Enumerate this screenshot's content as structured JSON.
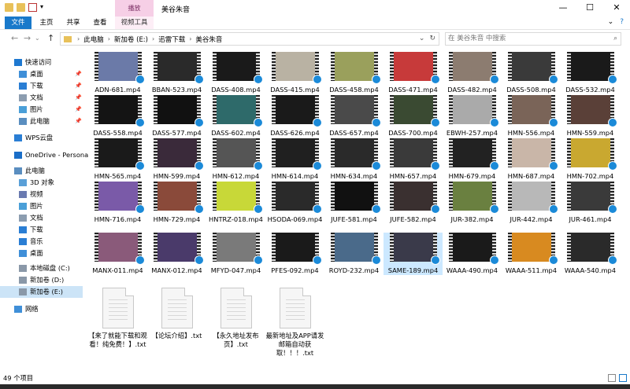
{
  "window": {
    "title": "美谷朱音",
    "context_tab": "播放",
    "minimize": "—",
    "maximize": "☐",
    "close": "✕"
  },
  "ribbon": {
    "tabs": [
      "文件",
      "主页",
      "共享",
      "查看",
      "视频工具"
    ]
  },
  "address": {
    "crumbs": [
      "此电脑",
      "新加卷 (E:)",
      "迅雷下载",
      "美谷朱音"
    ],
    "search_placeholder": "在 美谷朱音 中搜索",
    "back": "←",
    "forward": "→",
    "up": "↑",
    "dropdown": "⌄",
    "refresh": "↻"
  },
  "nav": {
    "items": [
      {
        "label": "快速访问",
        "icon": "star-icon"
      },
      {
        "label": "桌面",
        "icon": "desktop-icon",
        "pinned": true
      },
      {
        "label": "下载",
        "icon": "download-icon",
        "pinned": true
      },
      {
        "label": "文档",
        "icon": "document-icon",
        "pinned": true
      },
      {
        "label": "图片",
        "icon": "picture-icon",
        "pinned": true
      },
      {
        "label": "此电脑",
        "icon": "computer-icon",
        "pinned": true
      },
      {
        "label": "WPS云盘",
        "icon": "cloud-icon"
      },
      {
        "label": "OneDrive - Persona",
        "icon": "onedrive-icon"
      },
      {
        "label": "此电脑",
        "icon": "computer-icon"
      },
      {
        "label": "3D 对象",
        "icon": "cube-icon"
      },
      {
        "label": "视频",
        "icon": "video-icon"
      },
      {
        "label": "图片",
        "icon": "picture-icon"
      },
      {
        "label": "文档",
        "icon": "document-icon"
      },
      {
        "label": "下载",
        "icon": "download-icon"
      },
      {
        "label": "音乐",
        "icon": "music-icon"
      },
      {
        "label": "桌面",
        "icon": "desktop-icon"
      },
      {
        "label": "本地磁盘 (C:)",
        "icon": "drive-icon"
      },
      {
        "label": "新加卷 (D:)",
        "icon": "drive-icon"
      },
      {
        "label": "新加卷 (E:)",
        "icon": "drive-icon",
        "selected": true
      },
      {
        "label": "网络",
        "icon": "network-icon"
      }
    ]
  },
  "files": [
    {
      "name": "ADN-681.mp4",
      "color": "#6b7aa8"
    },
    {
      "name": "BBAN-523.mp4",
      "color": "#2a2a2a"
    },
    {
      "name": "DASS-408.mp4",
      "color": "#1a1a1a"
    },
    {
      "name": "DASS-415.mp4",
      "color": "#b9b2a3"
    },
    {
      "name": "DASS-458.mp4",
      "color": "#9aa05c"
    },
    {
      "name": "DASS-471.mp4",
      "color": "#c73a3a"
    },
    {
      "name": "DASS-482.mp4",
      "color": "#8c7c70"
    },
    {
      "name": "DASS-508.mp4",
      "color": "#3a3a3a"
    },
    {
      "name": "DASS-532.mp4",
      "color": "#1a1a1a"
    },
    {
      "name": "DASS-558.mp4",
      "color": "#141414"
    },
    {
      "name": "DASS-577.mp4",
      "color": "#111111"
    },
    {
      "name": "DASS-602.mp4",
      "color": "#2e6a6a"
    },
    {
      "name": "DASS-626.mp4",
      "color": "#1a1a1a"
    },
    {
      "name": "DASS-657.mp4",
      "color": "#4a4a4a"
    },
    {
      "name": "DASS-700.mp4",
      "color": "#3a4a32"
    },
    {
      "name": "EBWH-257.mp4",
      "color": "#aaaaaa"
    },
    {
      "name": "HMN-556.mp4",
      "color": "#7a6458"
    },
    {
      "name": "HMN-559.mp4",
      "color": "#5a4038"
    },
    {
      "name": "HMN-565.mp4",
      "color": "#1a1a1a"
    },
    {
      "name": "HMN-599.mp4",
      "color": "#3a2a3a"
    },
    {
      "name": "HMN-612.mp4",
      "color": "#555555"
    },
    {
      "name": "HMN-614.mp4",
      "color": "#202020"
    },
    {
      "name": "HMN-634.mp4",
      "color": "#2a2a2a"
    },
    {
      "name": "HMN-657.mp4",
      "color": "#3a3a3a"
    },
    {
      "name": "HMN-679.mp4",
      "color": "#222222"
    },
    {
      "name": "HMN-687.mp4",
      "color": "#c9b6a8"
    },
    {
      "name": "HMN-702.mp4",
      "color": "#c9a830"
    },
    {
      "name": "HMN-716.mp4",
      "color": "#7a5aa8"
    },
    {
      "name": "HMN-729.mp4",
      "color": "#8a4a3a"
    },
    {
      "name": "HNTRZ-018.mp4",
      "color": "#c8d838"
    },
    {
      "name": "HSODA-069.mp4",
      "color": "#2a2a2a"
    },
    {
      "name": "JUFE-581.mp4",
      "color": "#111111"
    },
    {
      "name": "JUFE-582.mp4",
      "color": "#3a3030"
    },
    {
      "name": "JUR-382.mp4",
      "color": "#6a8040"
    },
    {
      "name": "JUR-442.mp4",
      "color": "#b8b8b8"
    },
    {
      "name": "JUR-461.mp4",
      "color": "#3a3a3a"
    },
    {
      "name": "MANX-011.mp4",
      "color": "#8a5a7a"
    },
    {
      "name": "MANX-012.mp4",
      "color": "#4a3a6a"
    },
    {
      "name": "MFYD-047.mp4",
      "color": "#7a7a7a"
    },
    {
      "name": "PFES-092.mp4",
      "color": "#1a1a1a"
    },
    {
      "name": "ROYD-232.mp4",
      "color": "#4a6a8a"
    },
    {
      "name": "SAME-189.mp4",
      "color": "#3a3a4a",
      "selected": true
    },
    {
      "name": "WAAA-490.mp4",
      "color": "#1a1a1a"
    },
    {
      "name": "WAAA-511.mp4",
      "color": "#d88a20"
    },
    {
      "name": "WAAA-540.mp4",
      "color": "#2a2a2a"
    }
  ],
  "docs": [
    {
      "name": "【来了就能下载和观看！纯免费！】.txt"
    },
    {
      "name": "【论坛介绍】.txt"
    },
    {
      "name": "【永久地址发布页】.txt"
    },
    {
      "name": "最新地址及APP请发邮箱自动获取！！！.txt"
    }
  ],
  "status": {
    "count": "49 个项目"
  }
}
